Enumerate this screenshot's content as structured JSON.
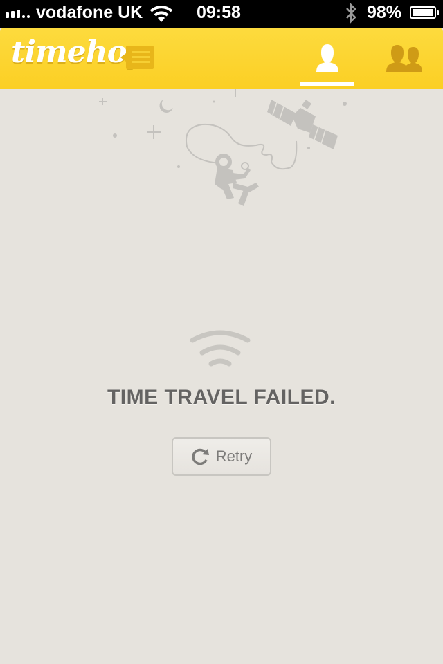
{
  "status_bar": {
    "carrier": "vodafone UK",
    "time": "09:58",
    "battery": "98%",
    "signal_bars": 3,
    "battery_level": 0.98
  },
  "header": {
    "logo_text": "timehop",
    "menu_icon": "feed-menu-icon",
    "tabs": [
      {
        "name": "me",
        "icon": "person-icon",
        "active": true
      },
      {
        "name": "friends",
        "icon": "friends-icon",
        "active": false
      }
    ]
  },
  "error": {
    "icon": "wifi-icon",
    "title": "TIME TRAVEL FAILED.",
    "retry_label": "Retry",
    "retry_icon": "refresh-icon"
  },
  "colors": {
    "header": "#fbd22f",
    "background": "#e6e3dd",
    "title_text": "#646362",
    "illustration": "#c4c2be"
  }
}
